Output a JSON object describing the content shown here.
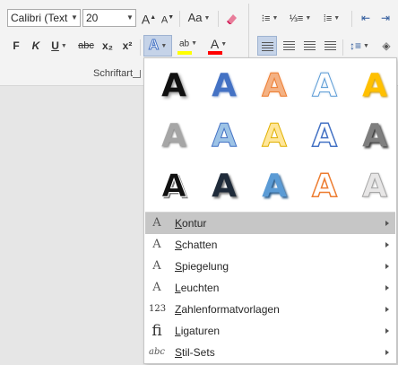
{
  "ribbon": {
    "font_name": "Calibri (Textk",
    "font_size": "20",
    "grow_font": "A",
    "shrink_font": "A",
    "change_case": "Aa",
    "bold": "F",
    "italic": "K",
    "underline": "U",
    "strikethrough": "abc",
    "subscript": "x₂",
    "superscript": "x²",
    "text_effects": "A",
    "highlight": "ab",
    "font_color": "A",
    "group_label": "Schriftart"
  },
  "gallery": {
    "glyph": "A",
    "effects": [
      "effect-1",
      "effect-2",
      "effect-3",
      "effect-4",
      "effect-5",
      "effect-6",
      "effect-7",
      "effect-8",
      "effect-9",
      "effect-10",
      "effect-11",
      "effect-12",
      "effect-13",
      "effect-14",
      "effect-15"
    ]
  },
  "menu": [
    {
      "key": "K",
      "rest": "ontur",
      "icon": "A",
      "active": true
    },
    {
      "key": "S",
      "rest": "chatten",
      "icon": "A",
      "active": false
    },
    {
      "key": "S",
      "rest": "piegelung",
      "icon": "A",
      "active": false
    },
    {
      "key": "L",
      "rest": "euchten",
      "icon": "A",
      "active": false
    },
    {
      "key": "Z",
      "rest": "ahlenformatvorlagen",
      "icon": "123",
      "active": false
    },
    {
      "key": "L",
      "rest": "igaturen",
      "icon": "fi",
      "active": false
    },
    {
      "key": "S",
      "rest": "til-Sets",
      "icon": "abc",
      "active": false
    }
  ],
  "colors": {
    "highlight_bar": "#ffff00",
    "font_color_bar": "#ff0000",
    "accent": "#2b579a"
  }
}
